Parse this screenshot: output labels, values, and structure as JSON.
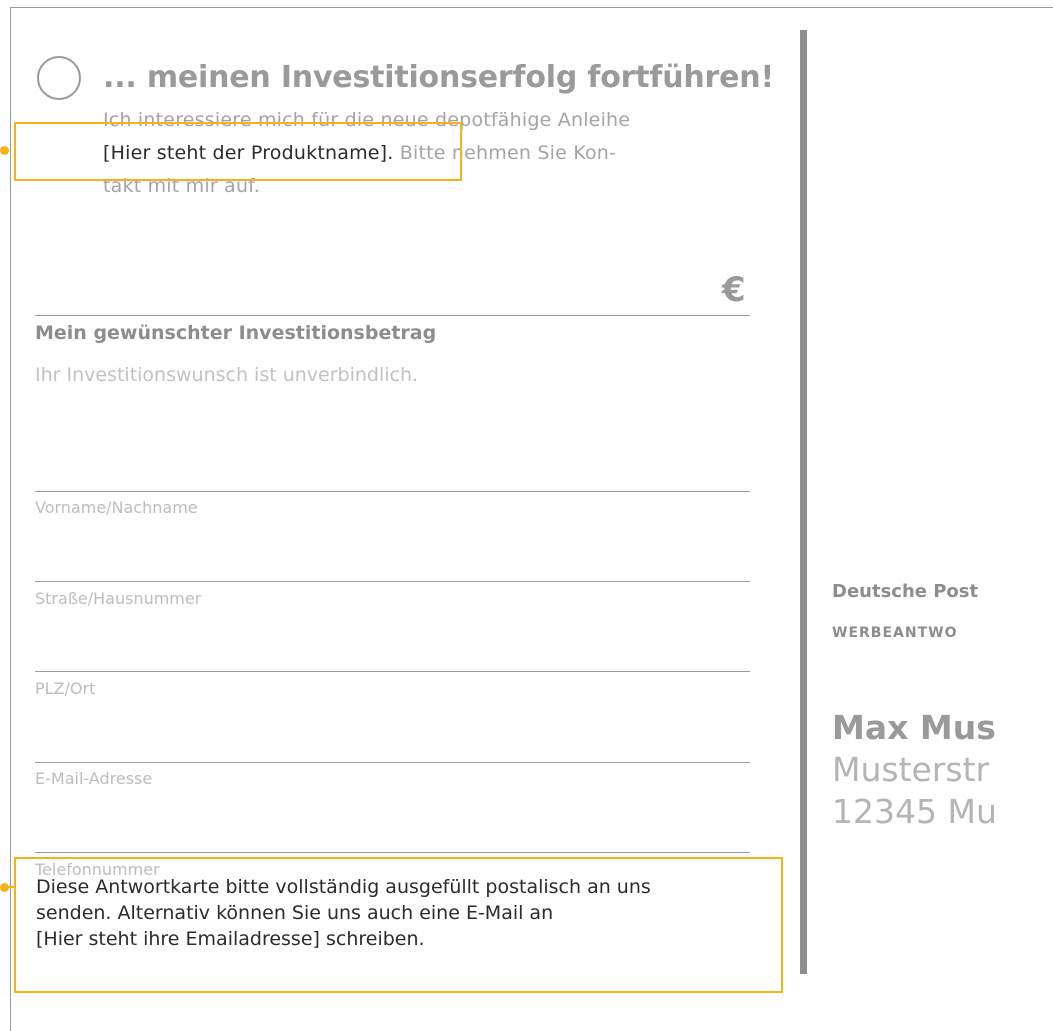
{
  "form": {
    "headline": "... meinen Investitionserfolg fortführen!",
    "intro_line1": "Ich interessiere mich für die neue depotfähige Anleihe",
    "intro_product": "[Hier steht der Produktname].",
    "intro_line2_rest": " Bitte nehmen Sie Kon-",
    "intro_line3": "takt mit mir auf.",
    "currency_symbol": "€",
    "amount_label": "Mein gewünschter Investitionsbetrag",
    "amount_note": "Ihr Investitionswunsch ist unverbindlich.",
    "fields": {
      "name": "Vorname/Nachname",
      "street": "Straße/Hausnummer",
      "city": "PLZ/Ort",
      "email": "E-Mail-Adresse",
      "phone": "Telefonnummer"
    },
    "footer_line1": "Diese Antwortkarte bitte vollständig ausgefüllt postalisch an uns",
    "footer_line2": "senden. Alternativ können Sie uns auch eine E-Mail an",
    "footer_line3": "[Hier steht ihre Emailadresse] schreiben."
  },
  "postal": {
    "carrier": "Deutsche Post",
    "service": "WERBEANTWO",
    "recipient_name": "Max Mus",
    "recipient_street": "Musterstr",
    "recipient_city": "12345 Mu"
  },
  "colors": {
    "highlight": "#f2b416",
    "text_dark": "#2b2b2b",
    "text_gray": "#9a9a9a"
  }
}
